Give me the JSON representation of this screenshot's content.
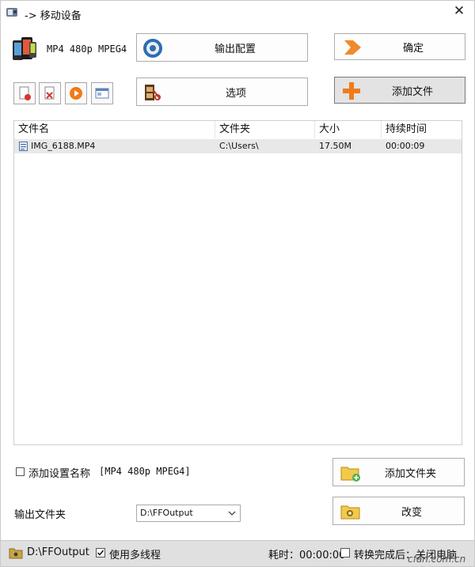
{
  "window": {
    "title": "-> 移动设备",
    "close_label": "✕"
  },
  "profile": {
    "label": "MP4 480p MPEG4"
  },
  "buttons": {
    "output_config": "输出配置",
    "confirm": "确定",
    "options": "选项",
    "add_file": "添加文件",
    "add_folder": "添加文件夹",
    "change": "改变"
  },
  "table": {
    "headers": [
      "文件名",
      "文件夹",
      "大小",
      "持续时间"
    ],
    "rows": [
      {
        "name": "IMG_6188.MP4",
        "folder": "C:\\Users\\",
        "size": "17.50M",
        "duration": "00:00:09"
      }
    ]
  },
  "options": {
    "add_setting_name_label": "添加设置名称",
    "add_setting_name_value": "[MP4 480p MPEG4]",
    "output_folder_label": "输出文件夹",
    "output_folder_value": "D:\\FFOutput"
  },
  "status": {
    "path": "D:\\FFOutput",
    "multithread_label": "使用多线程",
    "elapsed_label": "耗时：00:00:00",
    "after_convert_label": "转换完成后：关闭电脑",
    "watermark": "cfan.com.cn"
  }
}
